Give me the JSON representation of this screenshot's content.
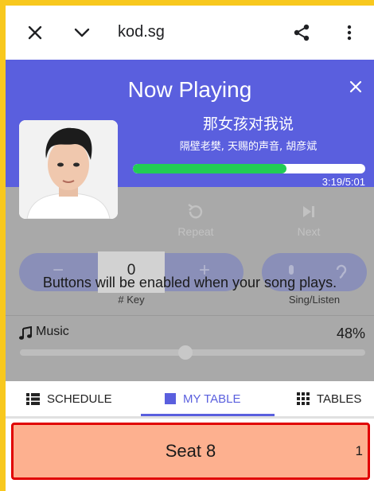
{
  "browser": {
    "url": "kod.sg",
    "icons": [
      "close-icon",
      "chevron-down-icon",
      "share-icon",
      "more-vert-icon"
    ]
  },
  "now_playing": {
    "title": "Now Playing",
    "song_title": "那女孩对我说",
    "song_artist": "隔壁老樊, 天赐的声音, 胡彦斌",
    "time": "3:19/5:01",
    "progress": 0.662,
    "accent_color": "#5a5fde",
    "progress_color": "#22cc55"
  },
  "controls": {
    "repeat_label": "Repeat",
    "next_label": "Next",
    "key_minus": "−",
    "key_plus": "+",
    "key_value": "0",
    "key_caption": "# Key",
    "sing_listen_caption": "Sing/Listen",
    "overlay_message": "Buttons will be enabled when your song plays."
  },
  "music": {
    "label": "Music",
    "percent": "48%",
    "level": 0.48
  },
  "tabs": [
    {
      "label": "SCHEDULE",
      "icon": "list-icon",
      "active": false
    },
    {
      "label": "MY TABLE",
      "icon": "square-icon",
      "active": true
    },
    {
      "label": "TABLES",
      "icon": "grid-icon",
      "active": false
    }
  ],
  "seat": {
    "label": "Seat 8",
    "count": "1",
    "background": "#fdb08f",
    "border": "#e00000"
  }
}
